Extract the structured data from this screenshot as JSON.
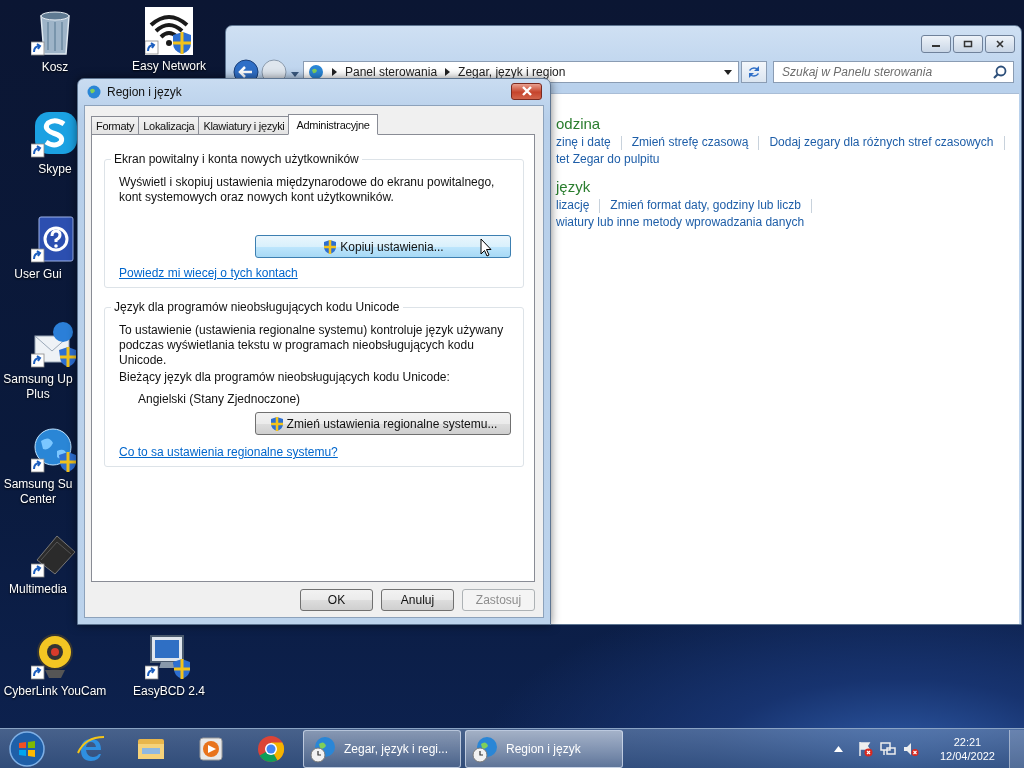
{
  "desktop_icons": [
    {
      "kind": "trash",
      "lines": [
        "Kosz"
      ]
    },
    {
      "kind": "wifi",
      "lines": [
        "Easy Network"
      ]
    },
    {
      "kind": "skype",
      "lines": [
        "Skype"
      ]
    },
    {
      "kind": "help",
      "lines": [
        "User Gui"
      ]
    },
    {
      "kind": "mail",
      "lines": [
        "Samsung Up",
        "Plus"
      ]
    },
    {
      "kind": "globe",
      "lines": [
        "Samsung Su",
        "Center"
      ]
    },
    {
      "kind": "laptop",
      "lines": [
        "Multimedia"
      ]
    },
    {
      "kind": "webcam",
      "lines": [
        "CyberLink YouCam"
      ]
    },
    {
      "kind": "monitor",
      "lines": [
        "EasyBCD 2.4"
      ]
    }
  ],
  "control_panel": {
    "breadcrumbs": [
      "Panel sterowania",
      "Zegar, język i region"
    ],
    "search": {
      "placeholder": "Szukaj w Panelu sterowania"
    },
    "sections": [
      {
        "heading": "odzina",
        "link_rows": [
          [
            "zinę i datę",
            "Zmień strefę czasową",
            "Dodaj zegary dla różnych stref czasowych"
          ],
          [
            "tet Zegar do pulpitu"
          ]
        ]
      },
      {
        "heading": "język",
        "link_rows": [
          [
            "lizację",
            "Zmień format daty, godziny lub liczb"
          ],
          [
            "wiatury lub inne metody wprowadzania danych"
          ]
        ]
      }
    ]
  },
  "dialog": {
    "title": "Region i język",
    "tabs": [
      {
        "label": "Formaty",
        "selected": false
      },
      {
        "label": "Lokalizacja",
        "selected": false
      },
      {
        "label": "Klawiatury i języki",
        "selected": false
      },
      {
        "label": "Administracyjne",
        "selected": true
      }
    ],
    "groups": [
      {
        "title": "Ekran powitalny i konta nowych użytkowników",
        "paragraphs": [
          "Wyświetl i skopiuj ustawienia międzynarodowe do ekranu powitalnego, kont systemowych oraz nowych kont użytkowników."
        ],
        "button": {
          "label": "Kopiuj ustawienia...",
          "hovered": true
        },
        "link": "Powiedz mi wiecej o tych kontach"
      },
      {
        "title": "Język dla programów nieobsługujących kodu Unicode",
        "paragraphs": [
          "To ustawienie (ustawienia regionalne systemu) kontroluje język używany podczas wyświetlania tekstu w programach nieobsługujących kodu Unicode.",
          "Bieżący język dla programów nieobsługujących kodu Unicode:"
        ],
        "value": "Angielski (Stany Zjednoczone)",
        "button": {
          "label": "Zmień ustawienia regionalne systemu...",
          "hovered": false
        },
        "link": "Co to sa ustawienia regionalne systemu?"
      }
    ],
    "buttons": [
      {
        "label": "OK",
        "disabled": false
      },
      {
        "label": "Anuluj",
        "disabled": false
      },
      {
        "label": "Zastosuj",
        "disabled": true
      }
    ]
  },
  "taskbar": {
    "tasks": [
      {
        "label": "Zegar, język i regi...",
        "selected": false
      },
      {
        "label": "Region i język",
        "selected": true
      }
    ],
    "clock": {
      "time": "22:21",
      "date": "12/04/2022"
    }
  }
}
